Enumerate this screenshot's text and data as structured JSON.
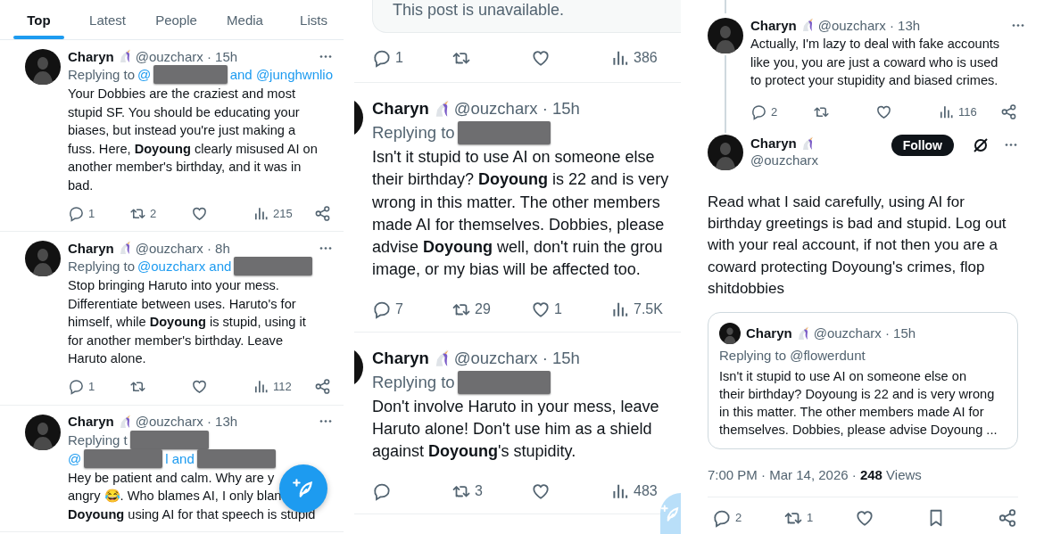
{
  "search_panel": {
    "tabs": [
      {
        "label": "Top",
        "selected": true
      },
      {
        "label": "Latest",
        "selected": false
      },
      {
        "label": "People",
        "selected": false
      },
      {
        "label": "Media",
        "selected": false
      },
      {
        "label": "Lists",
        "selected": false
      }
    ],
    "posts": [
      {
        "name": "Charyn",
        "meta": "@ouzcharx · 15h",
        "reply": [
          [
            {
              "kind": "text",
              "text": "Replying to"
            },
            {
              "kind": "link",
              "text": "@"
            },
            {
              "kind": "redacted"
            },
            {
              "kind": "link",
              "text": "and @junghwnlio"
            }
          ]
        ],
        "lines": [
          "Your Dobbies are the craziest and most",
          "stupid SF. You should be educating your",
          "biases, but instead you're just making a",
          "fuss. Here, **Doyoung** clearly misused AI on",
          "another member's birthday, and it was in",
          "bad."
        ],
        "actions": [
          {
            "kind": "reply",
            "count": "1"
          },
          {
            "kind": "repost",
            "count": "2"
          },
          {
            "kind": "like"
          },
          {
            "kind": "views",
            "count": "215"
          },
          {
            "kind": "share"
          }
        ]
      },
      {
        "name": "Charyn",
        "meta": "@ouzcharx · 8h",
        "reply": [
          [
            {
              "kind": "text",
              "text": "Replying to"
            },
            {
              "kind": "link",
              "text": "@ouzcharx and"
            },
            {
              "kind": "redacted"
            }
          ]
        ],
        "lines": [
          "Stop bringing Haruto into your mess.",
          "Differentiate between uses. Haruto's for",
          "himself, while **Doyoung** is stupid, using it",
          "for another member's birthday. Leave",
          "Haruto alone."
        ],
        "actions": [
          {
            "kind": "reply",
            "count": "1"
          },
          {
            "kind": "repost"
          },
          {
            "kind": "like"
          },
          {
            "kind": "views",
            "count": "112"
          },
          {
            "kind": "share"
          }
        ]
      },
      {
        "name": "Charyn",
        "meta": "@ouzcharx · 13h",
        "reply": [
          [
            {
              "kind": "text",
              "text": "Replying t"
            },
            {
              "kind": "redacted"
            }
          ],
          [
            {
              "kind": "link",
              "text": "@"
            },
            {
              "kind": "redacted"
            },
            {
              "kind": "link",
              "text": "l and"
            },
            {
              "kind": "redacted"
            }
          ]
        ],
        "lines": [
          "Hey be patient and calm. Why are y",
          "angry 😂. Who blames AI, I only blan",
          "**Doyoung** using AI for that speech is stupid"
        ]
      }
    ],
    "compose_button": {
      "kind": "solid"
    }
  },
  "replies_panel": {
    "unavailable_post": {
      "text": "This post is unavailable.",
      "actions": [
        {
          "kind": "reply",
          "count": "1"
        },
        {
          "kind": "repost"
        },
        {
          "kind": "like"
        },
        {
          "kind": "views",
          "count": "386"
        }
      ]
    },
    "posts": [
      {
        "name": "Charyn",
        "meta": "@ouzcharx · 15h",
        "reply": [
          [
            {
              "kind": "text",
              "text": "Replying to"
            },
            {
              "kind": "redacted"
            }
          ]
        ],
        "lines": [
          "Isn't it stupid to use AI on someone else",
          "their birthday? **Doyoung** is 22 and is very",
          "wrong in this matter. The other members",
          "made AI for themselves. Dobbies, please",
          "advise **Doyoung** well, don't ruin the grou",
          "image, or my bias will be affected too."
        ],
        "actions": [
          {
            "kind": "reply",
            "count": "7"
          },
          {
            "kind": "repost",
            "count": "29"
          },
          {
            "kind": "like",
            "count": "1"
          },
          {
            "kind": "views",
            "count": "7.5K"
          }
        ]
      },
      {
        "name": "Charyn",
        "meta": "@ouzcharx · 15h",
        "reply": [
          [
            {
              "kind": "text",
              "text": "Replying to"
            },
            {
              "kind": "redacted"
            }
          ]
        ],
        "lines": [
          "Don't involve Haruto in your mess, leave",
          "Haruto alone! Don't use him as a shield",
          "against **Doyoung**'s stupidity."
        ],
        "actions": [
          {
            "kind": "reply"
          },
          {
            "kind": "repost",
            "count": "3"
          },
          {
            "kind": "like"
          },
          {
            "kind": "views",
            "count": "483"
          }
        ]
      }
    ],
    "compose_button": {
      "kind": "faded"
    }
  },
  "thread_panel": {
    "parent_post": {
      "name": "Charyn",
      "meta": "@ouzcharx · 13h",
      "lines": [
        "Actually, I'm lazy to deal with fake accounts",
        "like you, you are just a coward who is used",
        "to protect your stupidity and biased crimes."
      ],
      "actions": [
        {
          "kind": "reply",
          "count": "2"
        },
        {
          "kind": "repost"
        },
        {
          "kind": "like"
        },
        {
          "kind": "views",
          "count": "116"
        },
        {
          "kind": "share"
        }
      ]
    },
    "main_post": {
      "name": "Charyn",
      "handle": "@ouzcharx",
      "follow_label": "Follow",
      "lines": [
        "Read what I said carefully, using AI for",
        "birthday greetings is bad and stupid. Log out",
        "with your real account, if not then you are a",
        "coward protecting Doyoung's crimes, flop",
        "shitdobbies"
      ],
      "quote": {
        "name": "Charyn",
        "meta": "@ouzcharx · 15h",
        "reply": "Replying to @flowerdunt",
        "lines": [
          "Isn't it stupid to use AI on someone else on",
          "their birthday? Doyoung is 22 and is very wrong",
          "in this matter. The other members made AI for",
          "themselves. Dobbies, please advise Doyoung ..."
        ]
      },
      "timestamp": "7:00 PM · Mar 14, 2026 · **248** Views",
      "actions": [
        {
          "kind": "reply",
          "count": "2"
        },
        {
          "kind": "repost",
          "count": "1"
        },
        {
          "kind": "like"
        },
        {
          "kind": "bookmark"
        },
        {
          "kind": "share"
        }
      ]
    }
  }
}
